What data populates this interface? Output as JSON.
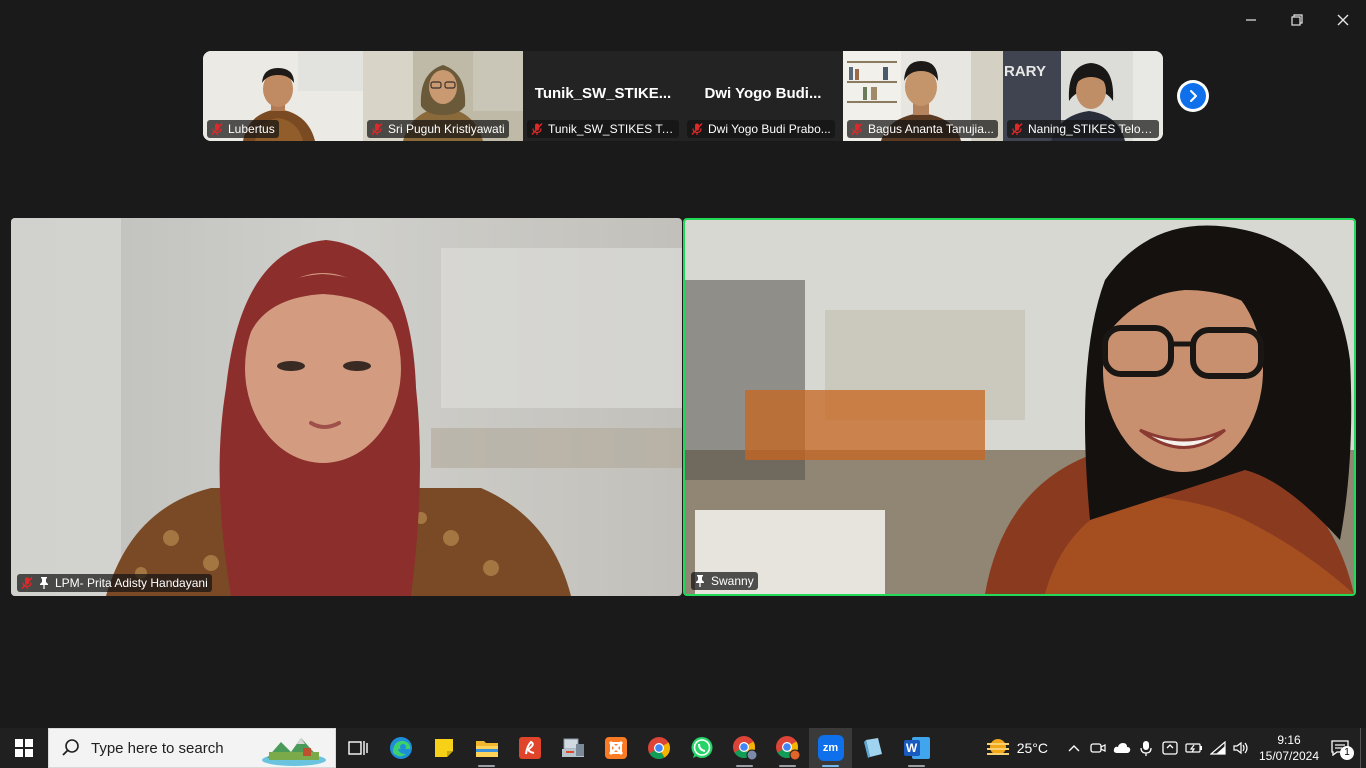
{
  "window": {
    "controls": [
      "minimize",
      "restore",
      "close"
    ]
  },
  "filmstrip": {
    "participants": [
      {
        "name": "Lubertus",
        "muted": true,
        "video": true
      },
      {
        "name": "Sri Puguh Kristiyawati",
        "muted": true,
        "video": true
      },
      {
        "name": "Tunik_SW_STIKES Telo...",
        "display": "Tunik_SW_STIKE...",
        "muted": true,
        "video": false
      },
      {
        "name": "Dwi Yogo Budi Prabo...",
        "display": "Dwi Yogo Budi...",
        "muted": true,
        "video": false
      },
      {
        "name": "Bagus Ananta Tanujia...",
        "muted": true,
        "video": true
      },
      {
        "name": "Naning_STIKES Telog...",
        "muted": true,
        "video": true
      }
    ],
    "next_icon": "chevron-right-icon",
    "background_sign": "RARY"
  },
  "main": {
    "left": {
      "name": "LPM- Prita Adisty Handayani",
      "muted": true,
      "pinned": true
    },
    "right": {
      "name": "Swanny",
      "muted": false,
      "pinned": true,
      "active_speaker": true,
      "highlight_color": "#23d959"
    }
  },
  "taskbar": {
    "search_placeholder": "Type here to search",
    "apps": [
      "task-view-icon",
      "edge-icon",
      "sticky-notes-icon",
      "file-explorer-icon",
      "pdf-reader-icon",
      "devices-icon",
      "xampp-icon",
      "chrome-icon",
      "whatsapp-icon",
      "chrome-profile-icon",
      "chrome-profile-2-icon",
      "zoom-icon",
      "notepad-icon",
      "word-icon"
    ],
    "zoom_label": "zm",
    "word_label": "W",
    "weather": {
      "temp": "25°C"
    },
    "clock": {
      "time": "9:16",
      "date": "15/07/2024"
    },
    "notification_count": "1"
  },
  "colors": {
    "zoom_blue": "#0e71eb",
    "muted_red": "#e02828",
    "active_green": "#23d959"
  }
}
